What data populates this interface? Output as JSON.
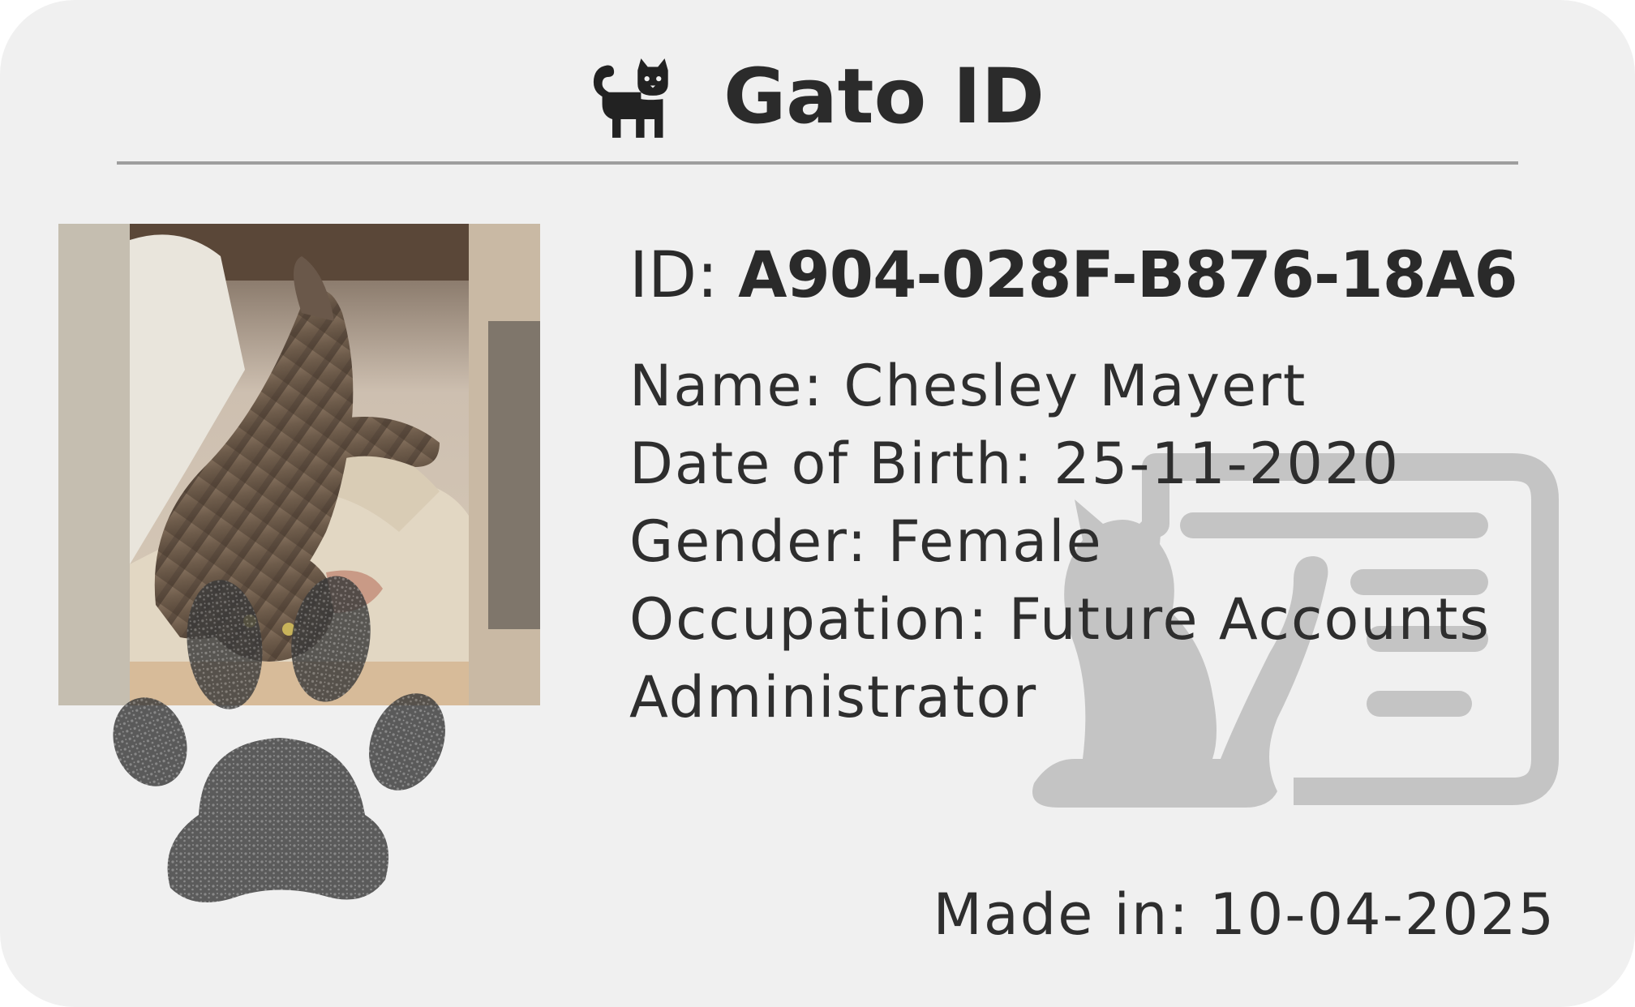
{
  "card": {
    "title": "Gato ID",
    "brand_icon": "cat-icon",
    "photo_alt": "tabby cat lying upside down",
    "id_label": "ID:",
    "id_value": "A904-028F-B876-18A6",
    "fields": [
      {
        "label": "Name:",
        "value": "Chesley Mayert"
      },
      {
        "label": "Date of Birth:",
        "value": "25-11-2020"
      },
      {
        "label": "Gender:",
        "value": "Female"
      },
      {
        "label": "Occupation:",
        "value": "Future Accounts Administrator"
      }
    ],
    "made_in_label": "Made in:",
    "made_in_value": "10-04-2025",
    "watermark_icon": "cat-id-card-icon",
    "stamp_icon": "paw-print-icon"
  },
  "colors": {
    "card_background": "#f0f0f0",
    "text": "#2e2e2e",
    "divider": "#9e9e9e",
    "watermark": "#c4c4c4",
    "paw_ink": "#3a3a3a"
  }
}
